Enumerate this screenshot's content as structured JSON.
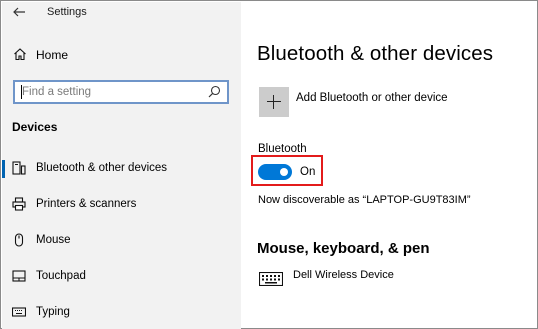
{
  "window": {
    "title": "Settings"
  },
  "sidebar": {
    "home_label": "Home",
    "search_placeholder": "Find a setting",
    "section_header": "Devices",
    "items": [
      {
        "label": "Bluetooth & other devices",
        "icon": "bluetooth-devices-icon",
        "selected": true
      },
      {
        "label": "Printers & scanners",
        "icon": "printer-icon",
        "selected": false
      },
      {
        "label": "Mouse",
        "icon": "mouse-icon",
        "selected": false
      },
      {
        "label": "Touchpad",
        "icon": "touchpad-icon",
        "selected": false
      },
      {
        "label": "Typing",
        "icon": "keyboard-icon",
        "selected": false
      }
    ]
  },
  "main": {
    "title": "Bluetooth & other devices",
    "add_device_label": "Add Bluetooth or other device",
    "bluetooth_label": "Bluetooth",
    "toggle_state": "On",
    "discoverable_text": "Now discoverable as “LAPTOP-GU9T83IM”",
    "section_title": "Mouse, keyboard, & pen",
    "devices": [
      {
        "name": "Dell Wireless Device",
        "icon": "keyboard-icon"
      }
    ]
  },
  "colors": {
    "sidebar_bg": "#f2f2f2",
    "accent": "#0078d7",
    "highlight_border": "#e31b1b",
    "search_border": "#6f95c9"
  }
}
